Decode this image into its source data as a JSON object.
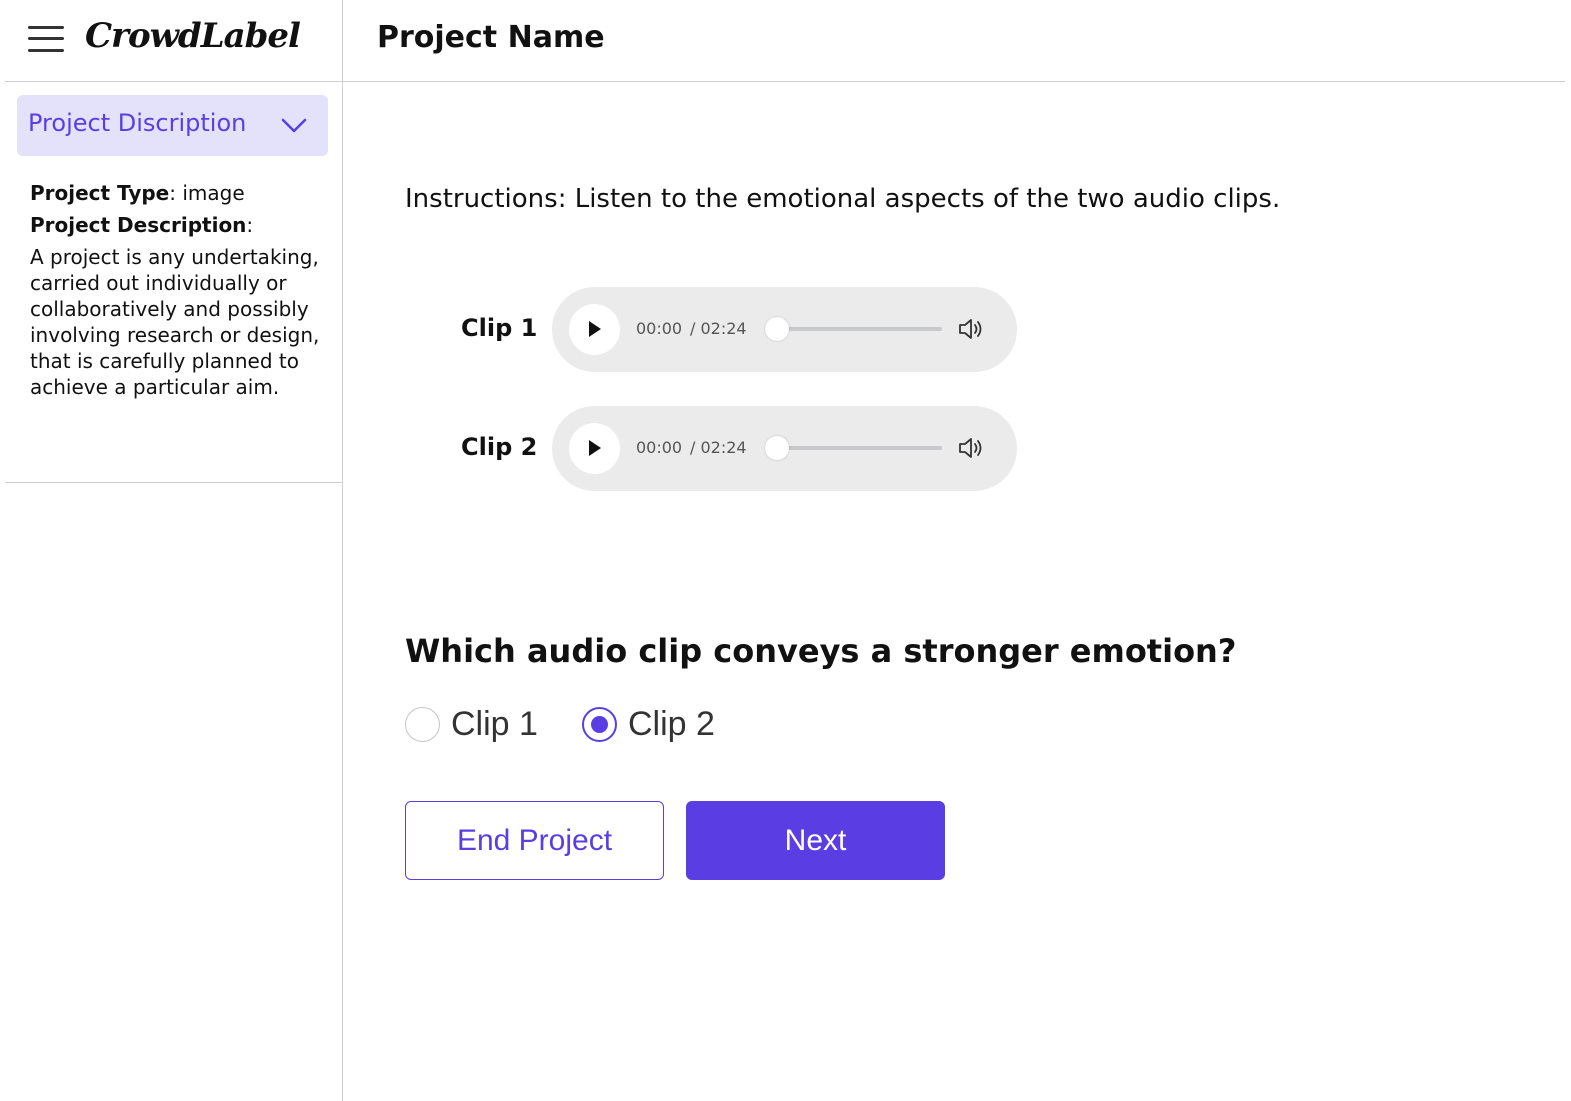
{
  "app": {
    "logo": "CrowdLabel"
  },
  "sidebar": {
    "toggle_label": "Project Discription",
    "project_type_label": "Project Type",
    "project_type_value": ": image",
    "project_description_label": "Project Description",
    "project_description_colon": ":",
    "project_description_text": "A project is any undertaking, carried out individually or collaboratively and possibly involving research or design, that is carefully planned to achieve a particular aim."
  },
  "header": {
    "title": "Project Name"
  },
  "main": {
    "instructions": "Instructions: Listen to the emotional aspects of the two audio clips.",
    "clips": [
      {
        "label": "Clip 1",
        "current_time": "00:00",
        "duration": "/ 02:24",
        "progress": 0
      },
      {
        "label": "Clip 2",
        "current_time": "00:00",
        "duration": "/ 02:24",
        "progress": 0
      }
    ],
    "question": "Which audio clip conveys a stronger emotion?",
    "options": [
      {
        "label": "Clip 1",
        "selected": false
      },
      {
        "label": "Clip 2",
        "selected": true
      }
    ],
    "end_button": "End Project",
    "next_button": "Next"
  },
  "colors": {
    "accent": "#5b3ee3",
    "accent_light": "#e4e2fb",
    "player_bg": "#ebebeb",
    "divider": "#cfcfcf"
  },
  "icons": [
    "hamburger-menu-icon",
    "chevron-down-icon",
    "play-icon",
    "volume-icon"
  ]
}
